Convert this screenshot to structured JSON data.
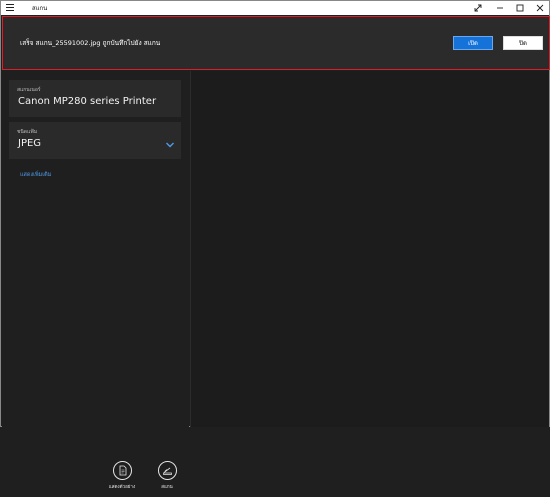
{
  "window": {
    "title": "สแกน",
    "controls": [
      "expand-icon",
      "minimize-icon",
      "maximize-icon",
      "close-icon"
    ]
  },
  "banner": {
    "message": "เสร็จ สแกน_25591002.jpg ถูกบันทึกไปยัง สแกน",
    "open_label": "เปิด",
    "close_label": "ปิด",
    "accent": "#1572d8",
    "border_color": "#d9202a"
  },
  "scanner": {
    "label": "สแกนเนอร์",
    "value": "Canon MP280 series Printer"
  },
  "file_type": {
    "label": "ชนิดแฟ้ม",
    "value": "JPEG"
  },
  "more_link": "แสดงเพิ่มเติม",
  "actions": {
    "preview_label": "แสดงตัวอย่าง",
    "scan_label": "สแกน"
  }
}
